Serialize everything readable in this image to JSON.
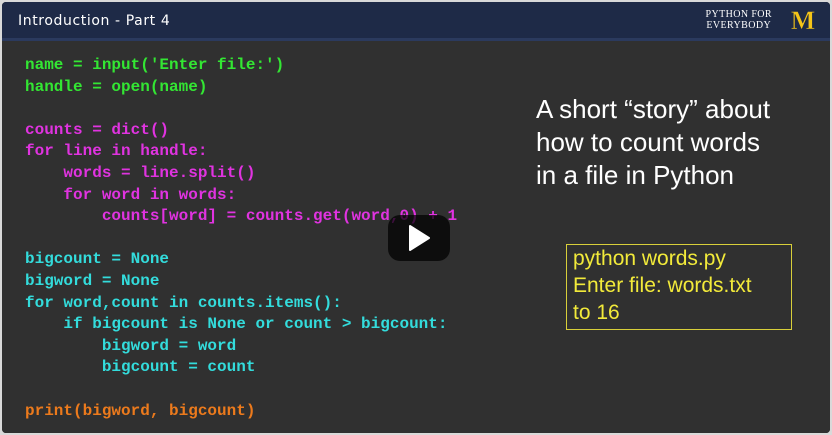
{
  "header": {
    "title": "Introduction - Part 4",
    "brand_line1": "PYTHON FOR",
    "brand_line2": "EVERYBODY",
    "logo_letter": "M"
  },
  "colors": {
    "green": "#33e633",
    "magenta": "#e033e0",
    "cyan": "#33dcdc",
    "orange": "#ec7a1c",
    "yellow": "#f2ea3a",
    "slide_bg": "#303030"
  },
  "code": [
    {
      "text": "name = input('Enter file:')",
      "color": "green"
    },
    {
      "text": "handle = open(name)",
      "color": "green"
    },
    {
      "text": "",
      "color": "green"
    },
    {
      "text": "counts = dict()",
      "color": "magenta"
    },
    {
      "text": "for line in handle:",
      "color": "magenta"
    },
    {
      "text": "    words = line.split()",
      "color": "magenta"
    },
    {
      "text": "    for word in words:",
      "color": "magenta"
    },
    {
      "text": "        counts[word] = counts.get(word,0) + 1",
      "color": "magenta"
    },
    {
      "text": "",
      "color": "magenta"
    },
    {
      "text": "bigcount = None",
      "color": "cyan"
    },
    {
      "text": "bigword = None",
      "color": "cyan"
    },
    {
      "text": "for word,count in counts.items():",
      "color": "cyan"
    },
    {
      "text": "    if bigcount is None or count > bigcount:",
      "color": "cyan"
    },
    {
      "text": "        bigword = word",
      "color": "cyan"
    },
    {
      "text": "        bigcount = count",
      "color": "cyan"
    },
    {
      "text": "",
      "color": "cyan"
    },
    {
      "text": "print(bigword, bigcount)",
      "color": "orange"
    }
  ],
  "story": {
    "line1": "A short “story” about",
    "line2": "how to count words",
    "line3": "in a file in Python"
  },
  "terminal": {
    "line1": "python words.py",
    "line2": "Enter file: words.txt",
    "line3": "to 16"
  },
  "play_icon": "play-icon"
}
